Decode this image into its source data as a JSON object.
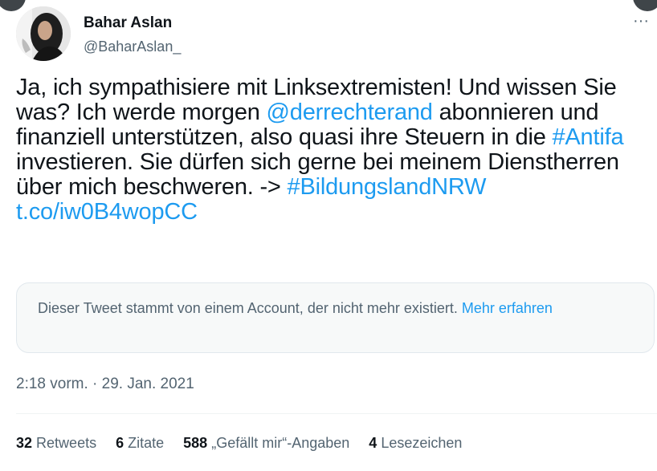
{
  "author": {
    "name": "Bahar Aslan",
    "handle": "@BaharAslan_"
  },
  "icons": {
    "more": "more-horizontal-icon",
    "avatar": "profile-photo"
  },
  "tweet": {
    "segments": [
      {
        "text": "Ja, ich sympathisiere mit Linksextremisten! Und wissen Sie was? Ich werde morgen ",
        "type": "text"
      },
      {
        "text": "@derrechterand",
        "type": "mention"
      },
      {
        "text": " abonnieren und finanziell unterstützen, also quasi ihre Steuern in die ",
        "type": "text"
      },
      {
        "text": "#Antifa",
        "type": "hashtag"
      },
      {
        "text": " investieren. Sie dürfen sich gerne bei meinem Dienstherren über mich beschweren. -> ",
        "type": "text"
      },
      {
        "text": "#BildungslandNRW",
        "type": "hashtag"
      },
      {
        "text": " ",
        "type": "text"
      },
      {
        "text": "t.co/iw0B4wopCC",
        "type": "url"
      }
    ]
  },
  "notice": {
    "text": "Dieser Tweet stammt von einem Account, der nicht mehr existiert. ",
    "link": "Mehr erfahren"
  },
  "timestamp": "2:18 vorm. · 29. Jan. 2021",
  "stats": {
    "retweets_count": "32",
    "retweets_label": "Retweets",
    "quotes_count": "6",
    "quotes_label": "Zitate",
    "likes_count": "588",
    "likes_label": "„Gefällt mir“-Angaben",
    "bookmarks_count": "4",
    "bookmarks_label": "Lesezeichen"
  },
  "colors": {
    "link": "#1d9bf0",
    "text": "#0f1419",
    "secondary": "#536471"
  }
}
